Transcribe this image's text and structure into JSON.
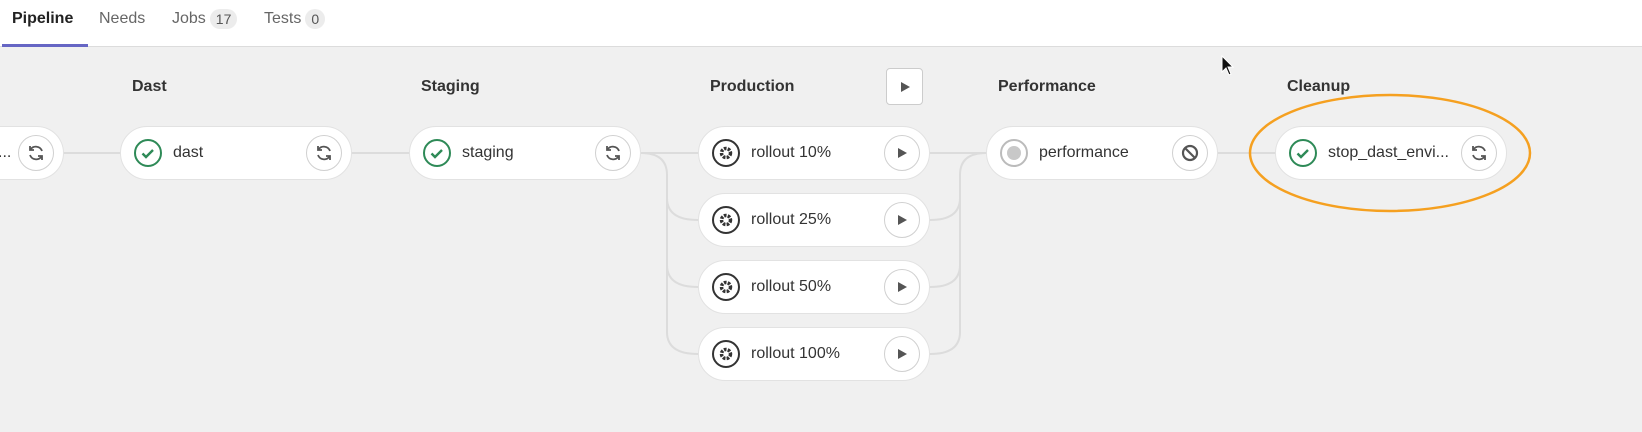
{
  "tabs": [
    {
      "label": "Pipeline",
      "active": true
    },
    {
      "label": "Needs"
    },
    {
      "label": "Jobs",
      "count": "17"
    },
    {
      "label": "Tests",
      "count": "0"
    }
  ],
  "stages": [
    {
      "title": "Dast",
      "jobs": [
        {
          "name": "dast",
          "status": "success",
          "action": "retry"
        }
      ]
    },
    {
      "title": "Staging",
      "jobs": [
        {
          "name": "staging",
          "status": "success",
          "action": "retry"
        }
      ]
    },
    {
      "title": "Production",
      "jobs": [
        {
          "name": "rollout 10%",
          "status": "manual",
          "action": "play"
        },
        {
          "name": "rollout 25%",
          "status": "manual",
          "action": "play"
        },
        {
          "name": "rollout 50%",
          "status": "manual",
          "action": "play"
        },
        {
          "name": "rollout 100%",
          "status": "manual",
          "action": "play"
        }
      ]
    },
    {
      "title": "Performance",
      "jobs": [
        {
          "name": "performance",
          "status": "created",
          "action": "cancel"
        }
      ]
    },
    {
      "title": "Cleanup",
      "jobs": [
        {
          "name": "stop_dast_envi...",
          "status": "success",
          "action": "retry"
        }
      ]
    }
  ],
  "previous_job": {
    "name": "...",
    "action": "retry"
  },
  "colors": {
    "accent": "#6666c4",
    "success": "#2e8a57",
    "highlight": "#f5a020"
  }
}
